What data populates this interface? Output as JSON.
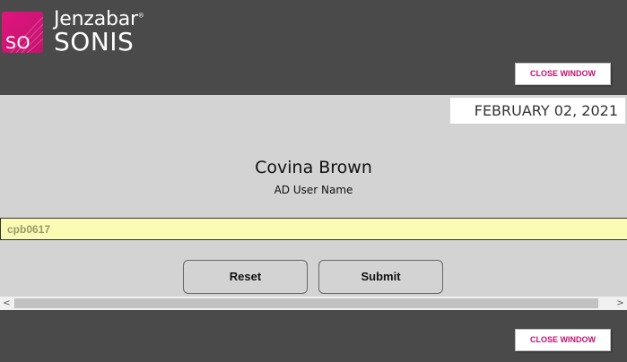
{
  "header": {
    "logo_mark": "SO",
    "brand_name": "Jenzabar",
    "brand_trademark": "®",
    "product_name": "SONIS",
    "close_window_label": "CLOSE WINDOW"
  },
  "date": "FEBRUARY 02, 2021",
  "form": {
    "user_full_name": "Covina Brown",
    "field_label": "AD User Name",
    "username_value": "cpb0617",
    "reset_label": "Reset",
    "submit_label": "Submit"
  },
  "scrollbar": {
    "left_arrow": "<",
    "right_arrow": ">"
  },
  "footer": {
    "close_window_label": "CLOSE WINDOW"
  },
  "colors": {
    "header_bg": "#4a4a4a",
    "accent": "#c2126f",
    "input_bg": "#fafcb4",
    "page_bg": "#d3d3d3"
  }
}
